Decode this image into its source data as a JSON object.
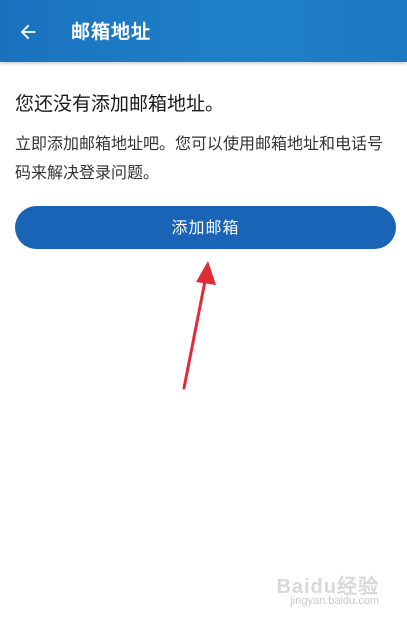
{
  "header": {
    "title": "邮箱地址",
    "back_icon": "arrow-left-icon"
  },
  "main": {
    "heading": "您还没有添加邮箱地址。",
    "description": "立即添加邮箱地址吧。您可以使用邮箱地址和电话号码来解决登录问题。",
    "add_button_label": "添加邮箱"
  },
  "watermark": {
    "logo_text": "Baidu经验",
    "url": "jingyan.baidu.com"
  },
  "colors": {
    "appbar": "#1c78c3",
    "button": "#1a64b8",
    "annotation_arrow": "#e12b36"
  }
}
